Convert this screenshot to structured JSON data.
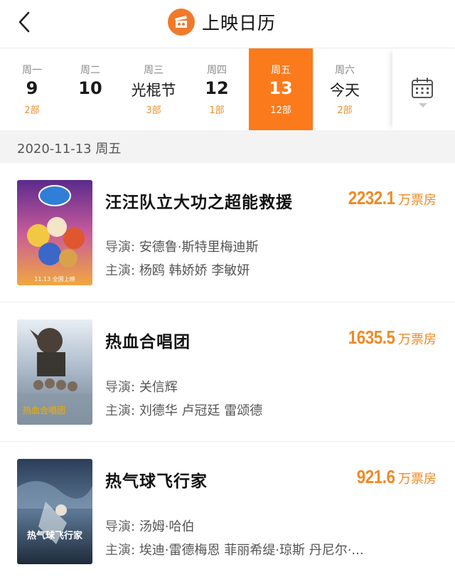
{
  "header": {
    "title": "上映日历",
    "back_icon": "chevron-left-icon",
    "logo_icon": "movie-clapper-icon",
    "accent": "#fb7a1c"
  },
  "days": [
    {
      "weekday": "周一",
      "date": "9",
      "count": "2部",
      "active": false
    },
    {
      "weekday": "周二",
      "date": "10",
      "count": "",
      "active": false
    },
    {
      "weekday": "周三",
      "date": "光棍节",
      "count": "3部",
      "active": false
    },
    {
      "weekday": "周四",
      "date": "12",
      "count": "1部",
      "active": false
    },
    {
      "weekday": "周五",
      "date": "13",
      "count": "12部",
      "active": true
    },
    {
      "weekday": "周六",
      "date": "今天",
      "count": "2部",
      "active": false
    }
  ],
  "calendar_button": {
    "icon": "calendar-icon"
  },
  "date_bar": {
    "label": "2020-11-13 周五"
  },
  "movies": [
    {
      "name": "汪汪队立大功之超能救援",
      "box_office": "2232.1",
      "unit": "万票房",
      "director_label": "导演:",
      "director": "安德鲁·斯特里梅迪斯",
      "cast_label": "主演:",
      "cast": "杨鸥 韩娇娇 李敏妍",
      "poster_text": "11.13 全国上映"
    },
    {
      "name": "热血合唱团",
      "box_office": "1635.5",
      "unit": "万票房",
      "director_label": "导演:",
      "director": "关信辉",
      "cast_label": "主演:",
      "cast": "刘德华 卢冠廷 雷颂德",
      "poster_text": "热血合唱团"
    },
    {
      "name": "热气球飞行家",
      "box_office": "921.6",
      "unit": "万票房",
      "director_label": "导演:",
      "director": "汤姆·哈伯",
      "cast_label": "主演:",
      "cast": "埃迪·雷德梅恩 菲丽希缇·琼斯 丹尼尔·...",
      "poster_text": "热气球飞行家"
    }
  ]
}
